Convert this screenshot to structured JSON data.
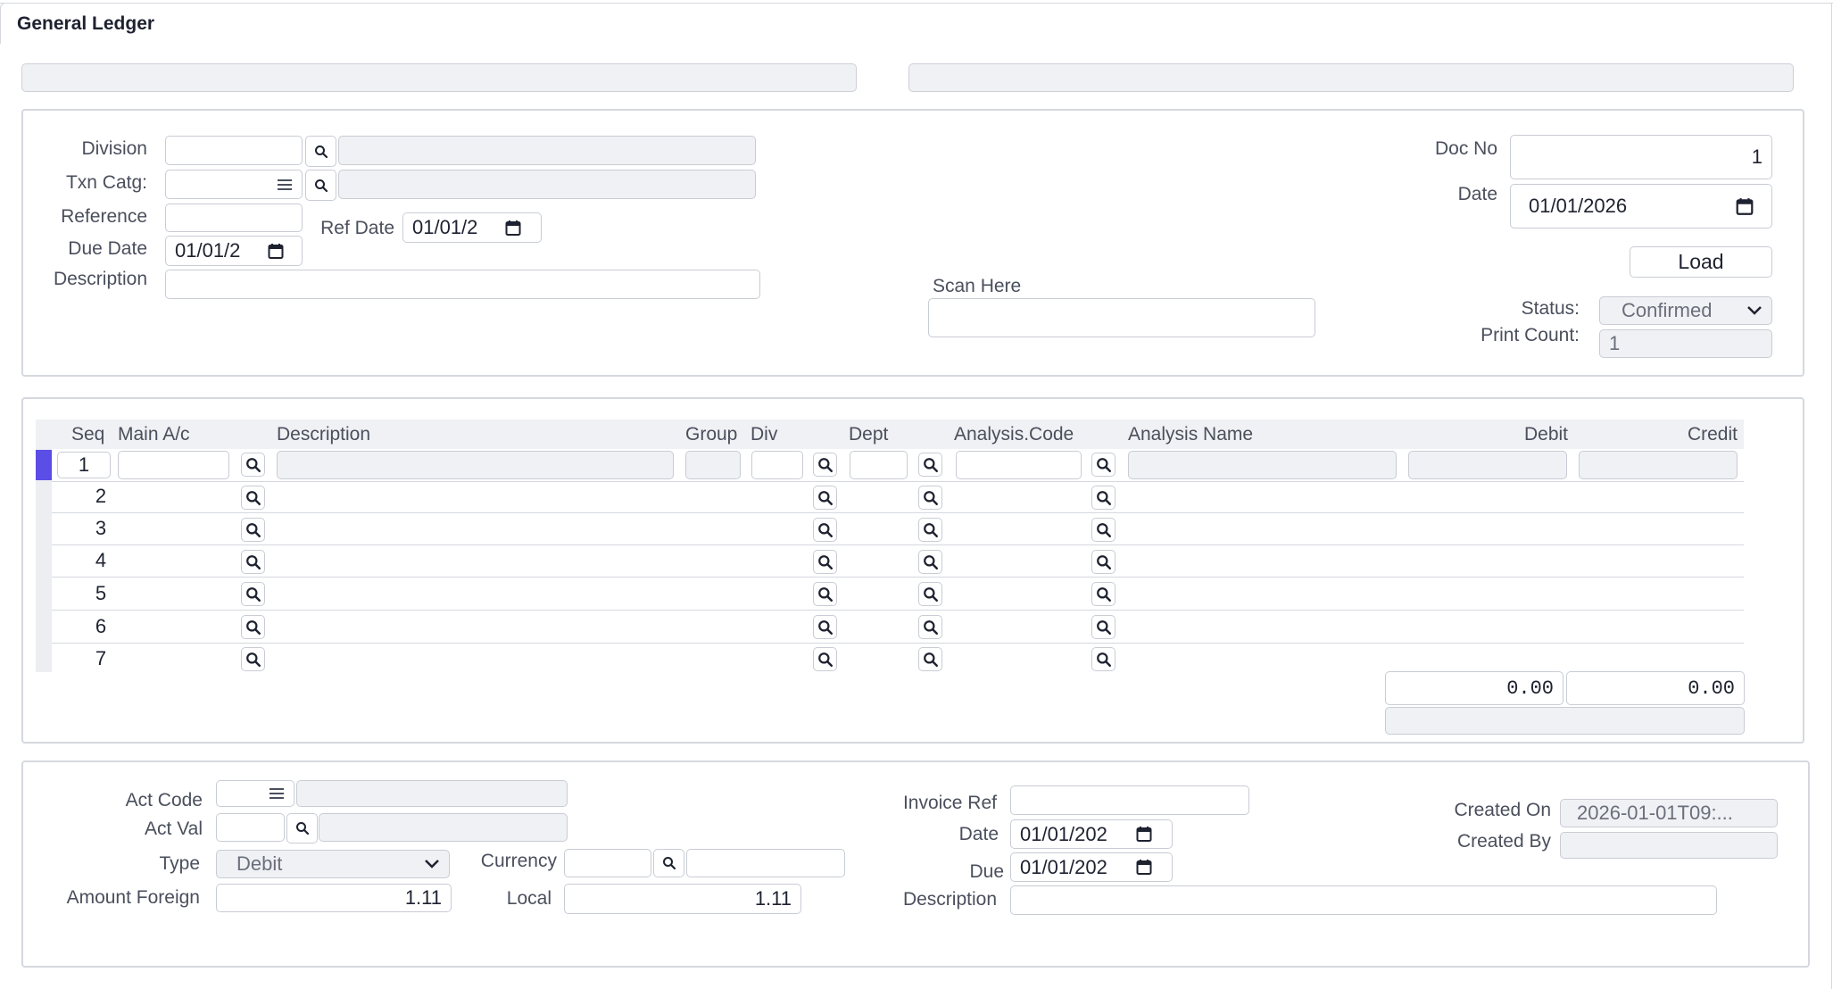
{
  "tab": {
    "title": "General Ledger"
  },
  "header": {
    "division_label": "Division",
    "txn_catg_label": "Txn Catg:",
    "reference_label": "Reference",
    "due_date_label": "Due Date",
    "due_date_value": "01/01/2",
    "ref_date_label": "Ref Date",
    "ref_date_value": "01/01/2",
    "description_label": "Description",
    "scan_label": "Scan Here",
    "doc_no_label": "Doc No",
    "doc_no_value": "1",
    "date_label": "Date",
    "date_value": "01/01/2026",
    "load_label": "Load",
    "status_label": "Status:",
    "status_value": "Confirmed",
    "print_count_label": "Print Count:",
    "print_count_value": "1"
  },
  "grid": {
    "columns": [
      "Seq",
      "Main A/c",
      "Description",
      "Group",
      "Div",
      "Dept",
      "Analysis.Code",
      "Analysis Name",
      "Debit",
      "Credit"
    ],
    "rows": [
      "1",
      "2",
      "3",
      "4",
      "5",
      "6",
      "7"
    ],
    "debit_total": "0.00",
    "credit_total": "0.00"
  },
  "detail": {
    "act_code_label": "Act Code",
    "act_val_label": "Act Val",
    "type_label": "Type",
    "type_value": "Debit",
    "currency_label": "Currency",
    "amount_foreign_label": "Amount Foreign",
    "amount_foreign_value": "1.11",
    "local_label": "Local",
    "local_value": "1.11",
    "invoice_ref_label": "Invoice Ref",
    "date_label": "Date",
    "date_value": "01/01/202",
    "due_label": "Due",
    "due_value": "01/01/202",
    "description_label": "Description",
    "created_on_label": "Created On",
    "created_on_value": "2026-01-01T09:...",
    "created_by_label": "Created By"
  },
  "colors": {
    "accent": "#5b4ee6",
    "border": "#d5d8de",
    "readonly_bg": "#f0f1f4"
  }
}
